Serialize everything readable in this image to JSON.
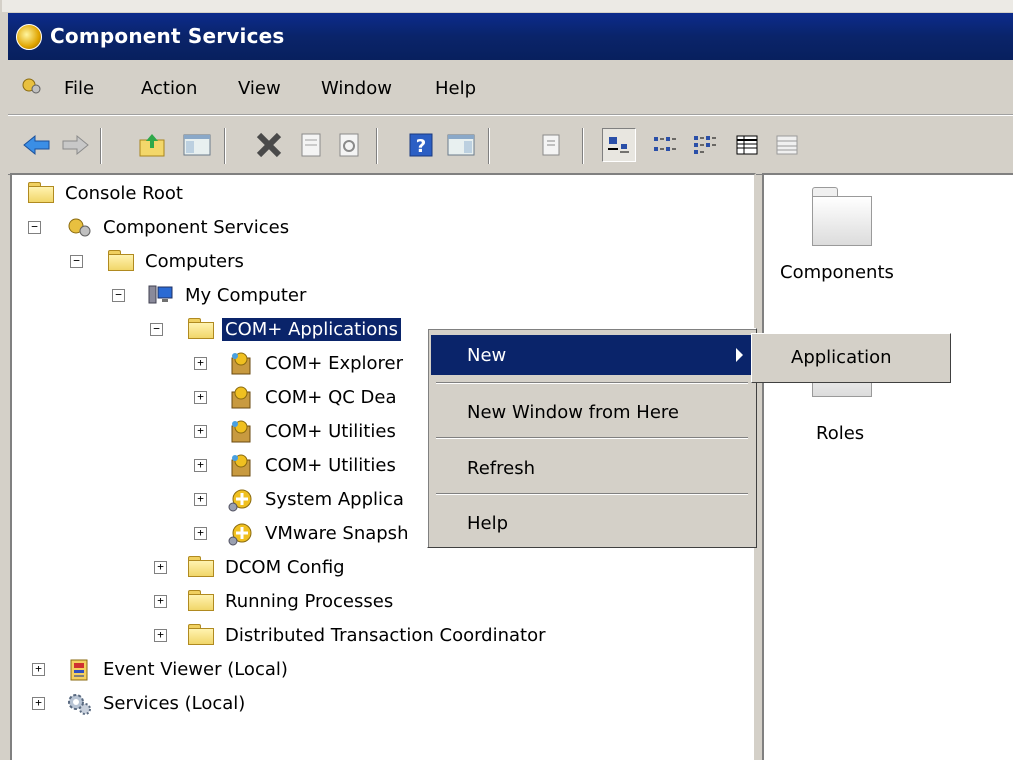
{
  "window": {
    "title": "Component Services"
  },
  "menubar": {
    "items": [
      "File",
      "Action",
      "View",
      "Window",
      "Help"
    ]
  },
  "toolbar": {
    "buttons": [
      "back-arrow-icon",
      "forward-arrow-icon",
      "up-folder-icon",
      "show-hide-tree-icon",
      "delete-icon",
      "properties-icon",
      "refresh-icon",
      "help-icon",
      "show-action-pane-icon",
      "export-list-icon",
      "large-icons-view-icon",
      "small-icons-view-icon",
      "list-view-icon",
      "detail-view-icon",
      "status-view-icon"
    ]
  },
  "tree": {
    "console_root": "Console Root",
    "component_services": "Component Services",
    "computers": "Computers",
    "my_computer": "My Computer",
    "com_applications": "COM+ Applications",
    "apps": [
      "COM+ Explorer",
      "COM+ QC Dea",
      "COM+ Utilities",
      "COM+ Utilities",
      "System Applica",
      "VMware Snapsh"
    ],
    "dcom_config": "DCOM Config",
    "running_processes": "Running Processes",
    "dtc": "Distributed Transaction Coordinator",
    "event_viewer": "Event Viewer (Local)",
    "services": "Services (Local)"
  },
  "context_menu": {
    "items": [
      "New",
      "New Window from Here",
      "Refresh",
      "Help"
    ],
    "submenu": [
      "Application"
    ]
  },
  "right_pane": {
    "items": [
      "Components",
      "Roles"
    ]
  },
  "colors": {
    "title_bar": "#0a246a",
    "selection": "#0a246a",
    "face": "#d4d0c8"
  }
}
